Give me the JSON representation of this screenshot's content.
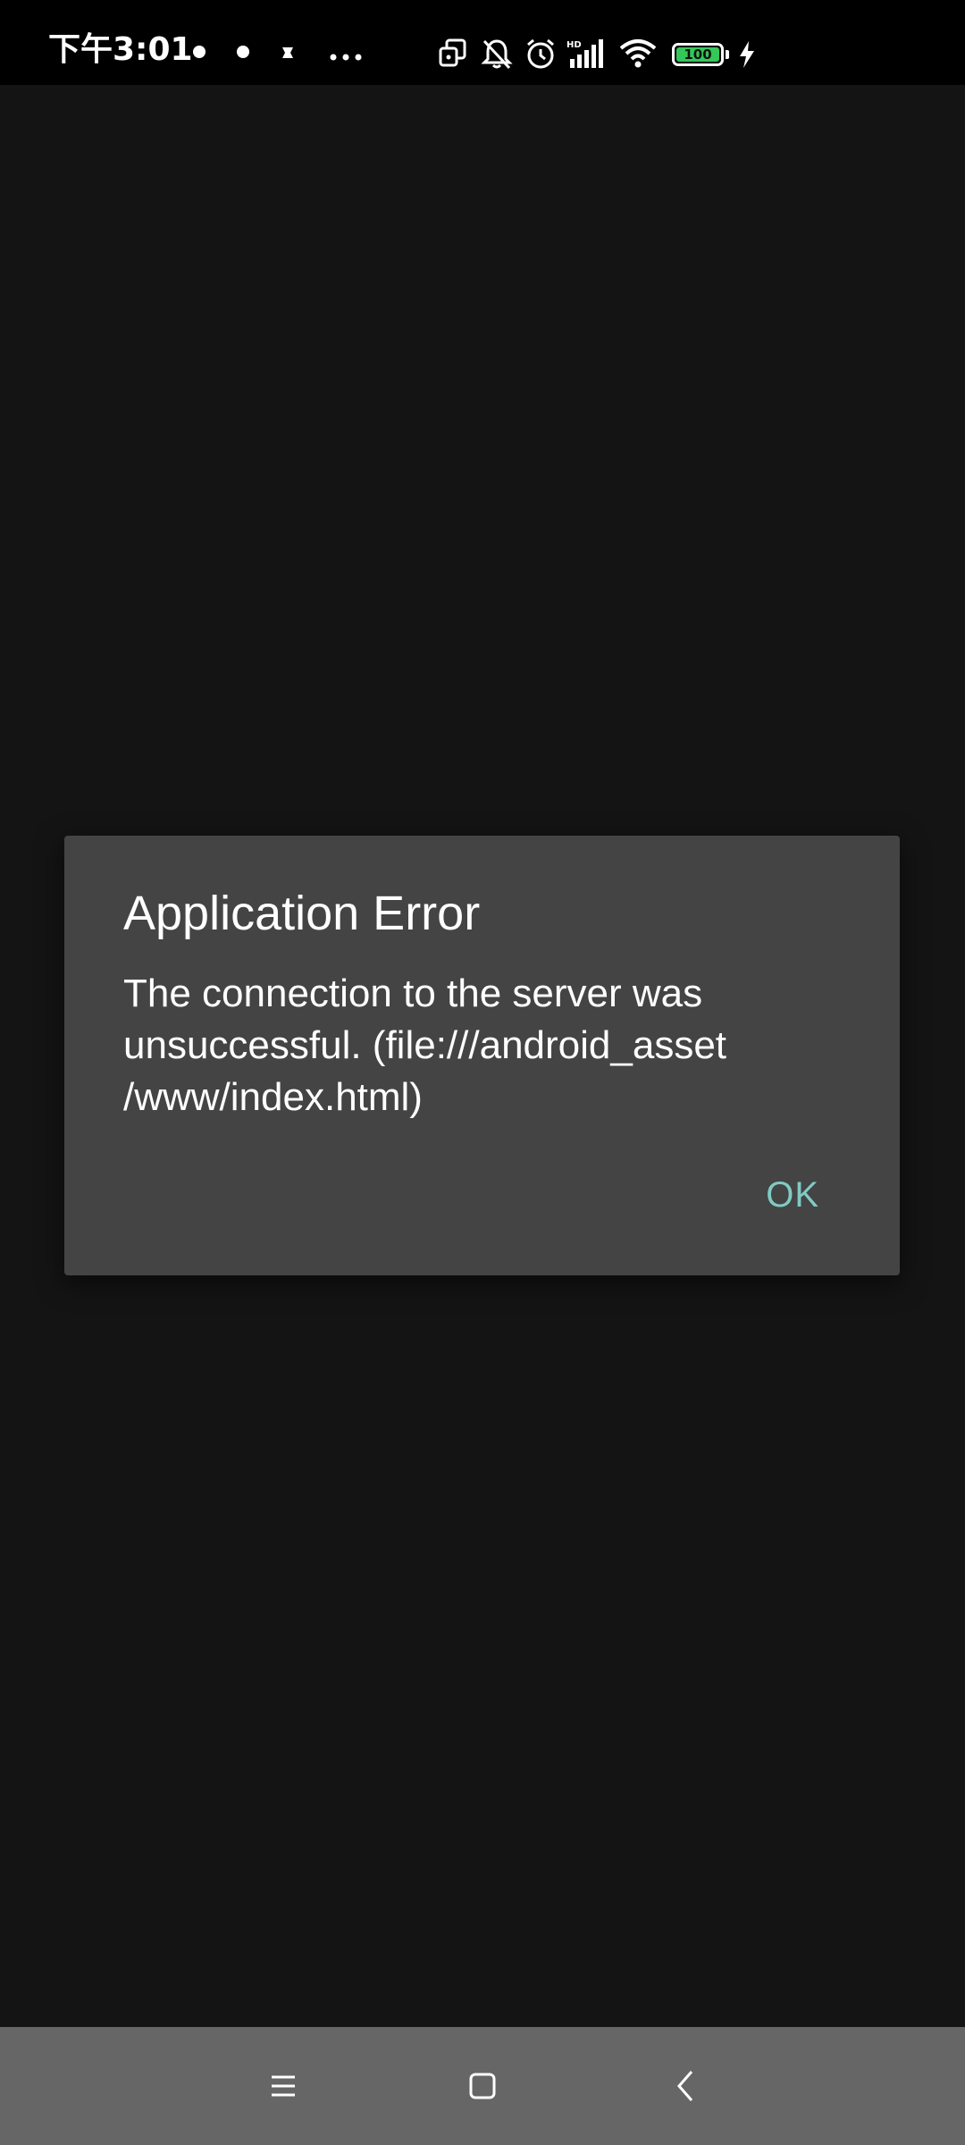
{
  "status_bar": {
    "time": "下午3:01",
    "battery_level": "100",
    "network_label": "HD"
  },
  "dialog": {
    "title": "Application Error",
    "message": "The connection to the server was unsuccessful. (file:///android_asset /www/index.html)",
    "ok_label": "OK"
  },
  "colors": {
    "accent": "#80cbc4",
    "dialog_bg": "#444444",
    "screen_bg": "#141414",
    "nav_bg": "#666666",
    "battery": "#34c759"
  },
  "icons": {
    "status": [
      "notification-dot-icon",
      "notification-dot-icon",
      "notification-app-icon",
      "more-dots-icon",
      "screen-mirror-icon",
      "bell-muted-icon",
      "alarm-icon",
      "signal-icon",
      "wifi-icon",
      "battery-icon",
      "charging-bolt-icon"
    ],
    "nav": [
      "menu-icon",
      "home-icon",
      "back-icon"
    ]
  }
}
